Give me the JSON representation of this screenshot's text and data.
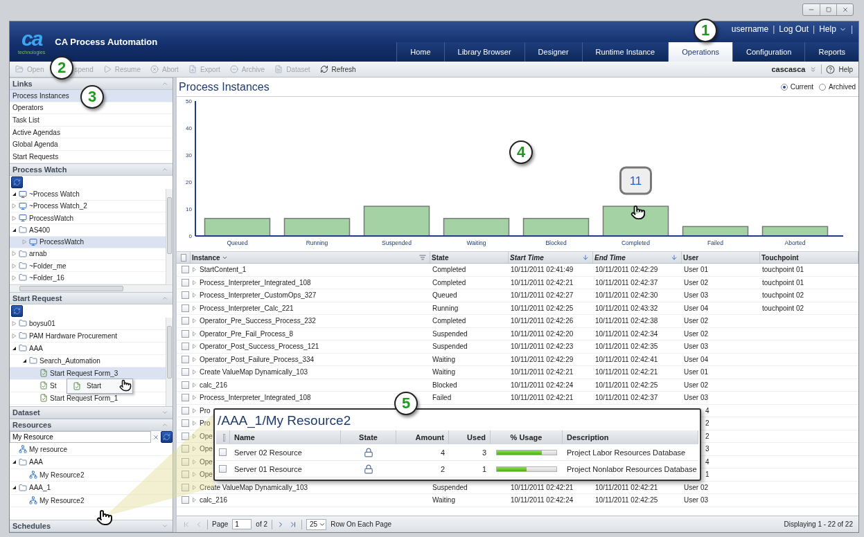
{
  "header": {
    "logo": "ca",
    "logo_sub": "technologies",
    "app_title": "CA Process Automation",
    "user_links": [
      {
        "label": "username",
        "menu": false,
        "separator": "|"
      },
      {
        "label": "Log Out",
        "menu": false,
        "separator": "|"
      },
      {
        "label": "Help",
        "menu": true,
        "separator": "|"
      }
    ],
    "tabs": [
      {
        "label": "Home",
        "selected": false
      },
      {
        "label": "Library Browser",
        "selected": false
      },
      {
        "label": "Designer",
        "selected": false
      },
      {
        "label": "Runtime Instance",
        "selected": false
      },
      {
        "label": "Operations",
        "selected": true
      },
      {
        "label": "Configuration",
        "selected": false
      },
      {
        "label": "Reports",
        "selected": false
      }
    ]
  },
  "toolbar": {
    "actions": [
      {
        "label": "Open",
        "disabled": true
      },
      {
        "label": "spend",
        "disabled": true
      },
      {
        "label": "Resume",
        "disabled": true
      },
      {
        "label": "Abort",
        "disabled": true
      },
      {
        "label": "Export",
        "disabled": true
      },
      {
        "label": "Archive",
        "disabled": true
      },
      {
        "label": "Dataset",
        "disabled": true
      },
      {
        "label": "Refresh",
        "disabled": false
      }
    ],
    "workspace": "cascasca",
    "help": "Help"
  },
  "sidebar": {
    "sections": [
      {
        "kind": "links",
        "title": "Links",
        "expanded": true,
        "items": [
          {
            "label": "Process Instances",
            "selected": true
          },
          {
            "label": "Operators",
            "selected": false
          },
          {
            "label": "Task List",
            "selected": false
          },
          {
            "label": "Active Agendas",
            "selected": false
          },
          {
            "label": "Global Agenda",
            "selected": false
          },
          {
            "label": "Start Requests",
            "selected": false
          }
        ]
      },
      {
        "kind": "tree",
        "title": "Process Watch",
        "expanded": true,
        "tree": [
          {
            "label": "~Process Watch",
            "kind": "monitor",
            "expanded": true,
            "selected": false
          },
          {
            "label": "~Process Watch_2",
            "kind": "monitor",
            "expanded": false,
            "selected": false
          },
          {
            "label": "ProcessWatch",
            "kind": "monitor",
            "expanded": false,
            "selected": false
          },
          {
            "label": "AS400",
            "kind": "folder",
            "expanded": true,
            "selected": false,
            "children": [
              {
                "label": "ProcessWatch",
                "kind": "monitor",
                "expanded": false,
                "selected": true
              }
            ]
          },
          {
            "label": "arnab",
            "kind": "folder",
            "expanded": false,
            "selected": false
          },
          {
            "label": "~Folder_me",
            "kind": "folder",
            "expanded": false,
            "selected": false
          },
          {
            "label": "~Folder_16",
            "kind": "folder",
            "expanded": false,
            "selected": false
          }
        ]
      },
      {
        "kind": "tree",
        "title": "Start Request",
        "expanded": true,
        "tree": [
          {
            "label": "boysu01",
            "kind": "folder",
            "expanded": false,
            "selected": false
          },
          {
            "label": "PAM Hardware Procurement",
            "kind": "folder",
            "expanded": false,
            "selected": false
          },
          {
            "label": "AAA",
            "kind": "folder",
            "expanded": true,
            "selected": false,
            "children": [
              {
                "label": "Search_Automation",
                "kind": "folder",
                "expanded": true,
                "selected": false,
                "children": [
                  {
                    "label": "Start Request Form_3",
                    "kind": "form",
                    "selected": true
                  },
                  {
                    "label": "St",
                    "kind": "form",
                    "selected": false
                  },
                  {
                    "label": "Start Request Form_1",
                    "kind": "form",
                    "selected": false
                  }
                ]
              }
            ]
          }
        ],
        "context_menu": {
          "items": [
            {
              "label": "Start"
            }
          ]
        }
      },
      {
        "title": "Dataset",
        "expanded": false
      },
      {
        "kind": "search_tree",
        "title": "Resources",
        "expanded": true,
        "search": {
          "value": "My Resource"
        },
        "tree": [
          {
            "label": "My resource",
            "kind": "resource",
            "selected": false
          },
          {
            "label": "AAA",
            "kind": "folder",
            "expanded": true,
            "selected": false,
            "children": [
              {
                "label": "My Resource2",
                "kind": "resource",
                "selected": false
              }
            ]
          },
          {
            "label": "AAA_1",
            "kind": "folder",
            "expanded": true,
            "selected": false,
            "children": [
              {
                "label": "My Resource2",
                "kind": "resource",
                "selected": false
              }
            ]
          }
        ]
      },
      {
        "title": "Schedules",
        "expanded": false
      }
    ]
  },
  "main": {
    "title": "Process Instances",
    "view_options": [
      {
        "label": "Current",
        "selected": true
      },
      {
        "label": "Archived",
        "selected": false
      }
    ],
    "chart_data": {
      "type": "bar",
      "categories": [
        "Queued",
        "Running",
        "Suspended",
        "Waiting",
        "Blocked",
        "Completed",
        "Failed",
        "Aborted"
      ],
      "values": [
        6.5,
        6.5,
        11,
        6.5,
        6.5,
        11,
        3.5,
        3.5
      ],
      "ylim": [
        0,
        50
      ],
      "yticks": [
        0,
        10,
        20,
        30,
        40,
        50
      ],
      "annotations": [
        {
          "x": "Completed",
          "text": "11"
        }
      ]
    },
    "table": {
      "select_all_checked": false,
      "columns": [
        {
          "label": "Instance",
          "kind": "menu"
        },
        {
          "label": "State",
          "kind": "plain"
        },
        {
          "label": "Start Time",
          "kind": "sort"
        },
        {
          "label": "End Time",
          "kind": "sort"
        },
        {
          "label": "User",
          "kind": "plain"
        },
        {
          "label": "Touchpoint",
          "kind": "plain"
        }
      ],
      "rows": [
        {
          "kind": "full",
          "checked": false,
          "instance": "StartContent_1",
          "state": "Completed",
          "start": "10/11/2011 02:41:49",
          "end": "10/11/2011 02:42:29",
          "user": "User 01",
          "touchpoint": "touchpoint 01"
        },
        {
          "kind": "full",
          "checked": false,
          "instance": "Process_Interpreter_Integrated_108",
          "state": "Completed",
          "start": "10/11/2011 02:42:21",
          "end": "10/11/2011 02:42:37",
          "user": "User 02",
          "touchpoint": "touchpoint 01"
        },
        {
          "kind": "full",
          "checked": false,
          "instance": "Process_Interpreter_CustomOps_327",
          "state": "Queued",
          "start": "10/11/2011 02:42:27",
          "end": "10/11/2011 02:42:30",
          "user": "User 03",
          "touchpoint": "touchpoint 02"
        },
        {
          "kind": "full",
          "checked": false,
          "instance": "Process_Interpreter_Calc_221",
          "state": "Running",
          "start": "10/11/2011 02:42:25",
          "end": "10/11/2011 02:43:32",
          "user": "User 04",
          "touchpoint": "touchpoint 02"
        },
        {
          "kind": "full",
          "checked": false,
          "instance": "Operator_Pre_Success_Process_232",
          "state": "Completed",
          "start": "10/11/2011 02:42:26",
          "end": "10/11/2011 02:42:38",
          "user": "User 02"
        },
        {
          "kind": "full",
          "checked": false,
          "instance": "Operator_Pre_Fail_Process_8",
          "state": "Suspended",
          "start": "10/11/2011 02:42:20",
          "end": "10/11/2011 02:42:34",
          "user": "User 02"
        },
        {
          "kind": "full",
          "checked": false,
          "instance": "Operator_Post_Success_Process_121",
          "state": "Suspended",
          "start": "10/11/2011 02:42:23",
          "end": "10/11/2011 02:42:35",
          "user": "User 03"
        },
        {
          "kind": "full",
          "checked": false,
          "instance": "Operator_Post_Failure_Process_334",
          "state": "Waiting",
          "start": "10/11/2011 02:42:29",
          "end": "10/11/2011 02:42:41",
          "user": "User 04"
        },
        {
          "kind": "full",
          "checked": false,
          "instance": "Create ValueMap Dynamically_103",
          "state": "Waiting",
          "start": "10/11/2011 02:42:21",
          "end": "10/11/2011 02:42:21",
          "user": "User 01"
        },
        {
          "kind": "full",
          "checked": false,
          "instance": "calc_216",
          "state": "Blocked",
          "start": "10/11/2011 02:42:24",
          "end": "10/11/2011 02:42:25",
          "user": "User 02"
        },
        {
          "kind": "full",
          "checked": false,
          "instance": "Process_Interpreter_Integrated_108",
          "state": "Failed",
          "start": "10/11/2011 02:42:21",
          "end": "10/11/2011 02:42:37",
          "user": "User 03"
        },
        {
          "kind": "covered",
          "checked": false,
          "instance": "Pro",
          "user": "4"
        },
        {
          "kind": "covered",
          "checked": false,
          "instance": "Pro",
          "user": "2"
        },
        {
          "kind": "covered",
          "checked": false,
          "instance": "Ope",
          "user": "2"
        },
        {
          "kind": "covered",
          "checked": false,
          "instance": "Ope",
          "user": "3"
        },
        {
          "kind": "covered",
          "checked": false,
          "instance": "Ope",
          "user": "4"
        },
        {
          "kind": "covered",
          "checked": false,
          "instance": "Ope",
          "user": "1"
        },
        {
          "kind": "full",
          "checked": false,
          "instance": "Create ValueMap Dynamically_103",
          "state": "Suspended",
          "start": "10/11/2011 02:42:21",
          "end": "10/11/2011 02:42:21",
          "user": "User 02"
        },
        {
          "kind": "full",
          "checked": false,
          "instance": "calc_216",
          "state": "Waiting",
          "start": "10/11/2011 02:42:24",
          "end": "10/11/2011 02:42:25",
          "user": "User 03"
        }
      ]
    },
    "pager": {
      "page_label": "Page",
      "page": "1",
      "of": "of 2",
      "page_size": "25",
      "page_size_label": "Row On Each Page",
      "display": "Displaying 1 - 22 of 22"
    },
    "resource_popup": {
      "title": "/AAA_1/My Resource2",
      "select_all_checked": false,
      "columns": [
        "Name",
        "State",
        "Amount",
        "Used",
        "% Usage",
        "Description"
      ],
      "rows": [
        {
          "checked": false,
          "name": "Server 02 Resource",
          "locked": true,
          "amount": "4",
          "used": "3",
          "level": 0.75,
          "description": "Project Labor Resources Database"
        },
        {
          "checked": false,
          "name": "Server 01 Resource",
          "locked": true,
          "amount": "2",
          "used": "1",
          "level": 0.5,
          "description": "Project Nonlabor Resources Database"
        }
      ]
    }
  },
  "callouts": [
    "1",
    "2",
    "3",
    "4",
    "5"
  ]
}
